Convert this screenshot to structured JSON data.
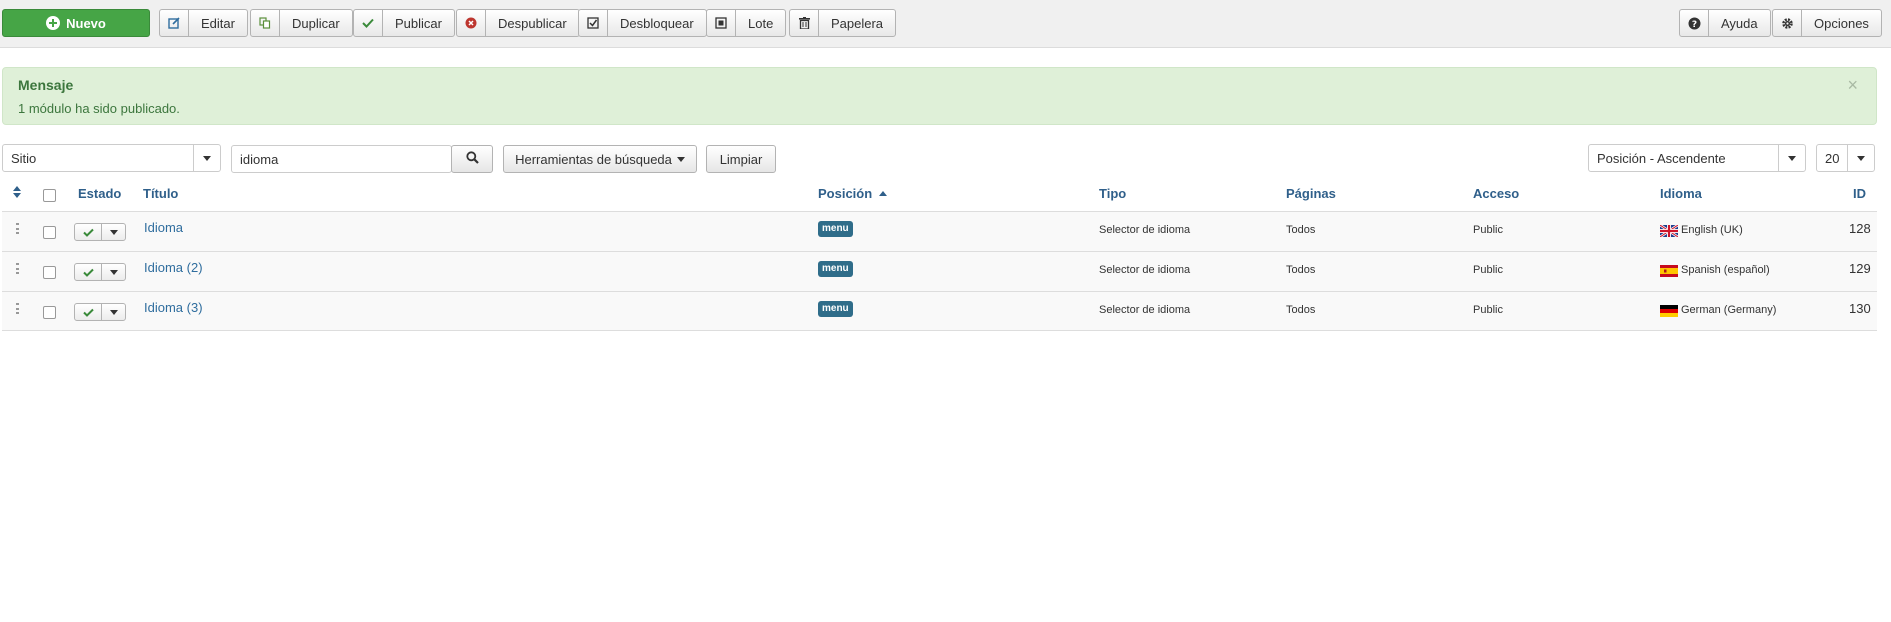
{
  "toolbar": {
    "new_label": "Nuevo",
    "edit_label": "Editar",
    "duplicate_label": "Duplicar",
    "publish_label": "Publicar",
    "unpublish_label": "Despublicar",
    "unlock_label": "Desbloquear",
    "batch_label": "Lote",
    "trash_label": "Papelera",
    "help_label": "Ayuda",
    "options_label": "Opciones"
  },
  "message": {
    "title": "Mensaje",
    "text": "1 módulo ha sido publicado.",
    "close": "×"
  },
  "filters": {
    "client_select": "Sitio",
    "search_value": "idioma",
    "search_tools_label": "Herramientas de búsqueda",
    "clear_label": "Limpiar",
    "ordering_select": "Posición - Ascendente",
    "limit_select": "20"
  },
  "table": {
    "headers": {
      "status": "Estado",
      "title": "Título",
      "position": "Posición",
      "type": "Tipo",
      "pages": "Páginas",
      "access": "Acceso",
      "language": "Idioma",
      "id": "ID"
    },
    "rows": [
      {
        "title": "Idioma",
        "position": "menu",
        "type": "Selector de idioma",
        "pages": "Todos",
        "access": "Public",
        "language": "English (UK)",
        "flag": "uk-flag",
        "id": "128"
      },
      {
        "title": "Idioma (2)",
        "position": "menu",
        "type": "Selector de idioma",
        "pages": "Todos",
        "access": "Public",
        "language": "Spanish (español)",
        "flag": "es-flag",
        "id": "129"
      },
      {
        "title": "Idioma (3)",
        "position": "menu",
        "type": "Selector de idioma",
        "pages": "Todos",
        "access": "Public",
        "language": "German (Germany)",
        "flag": "de-flag",
        "id": "130"
      }
    ]
  },
  "colors": {
    "new_button": "#46a546",
    "message_bg": "#dff0d8",
    "message_text": "#3c763d",
    "link": "#2f6d9e",
    "badge": "#2f6d8a"
  }
}
